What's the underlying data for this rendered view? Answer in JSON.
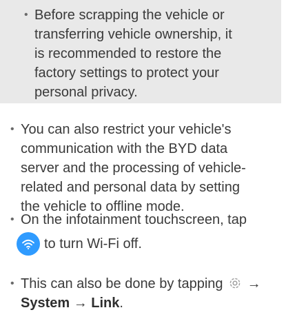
{
  "note": {
    "text": "Before scrapping the vehicle or transferring vehicle ownership, it is recommended to restore the factory settings to protect your personal privacy."
  },
  "bullets": {
    "offline": "You can also restrict your vehicle's communication with the BYD data server and the processing of vehicle-related and personal data by setting the vehicle to offline mode.",
    "touchscreen_prefix": "On the infotainment touchscreen, tap",
    "touchscreen_suffix": "to turn Wi-Fi off.",
    "alt_prefix": "This can also be done by tapping",
    "arrow1": "→",
    "system_label": "System",
    "arrow2": "→",
    "link_label": "Link",
    "end_punct": "."
  },
  "icons": {
    "wifi": "wifi-icon",
    "settings": "gear-icon",
    "wifi_color": "#2f9bff"
  }
}
